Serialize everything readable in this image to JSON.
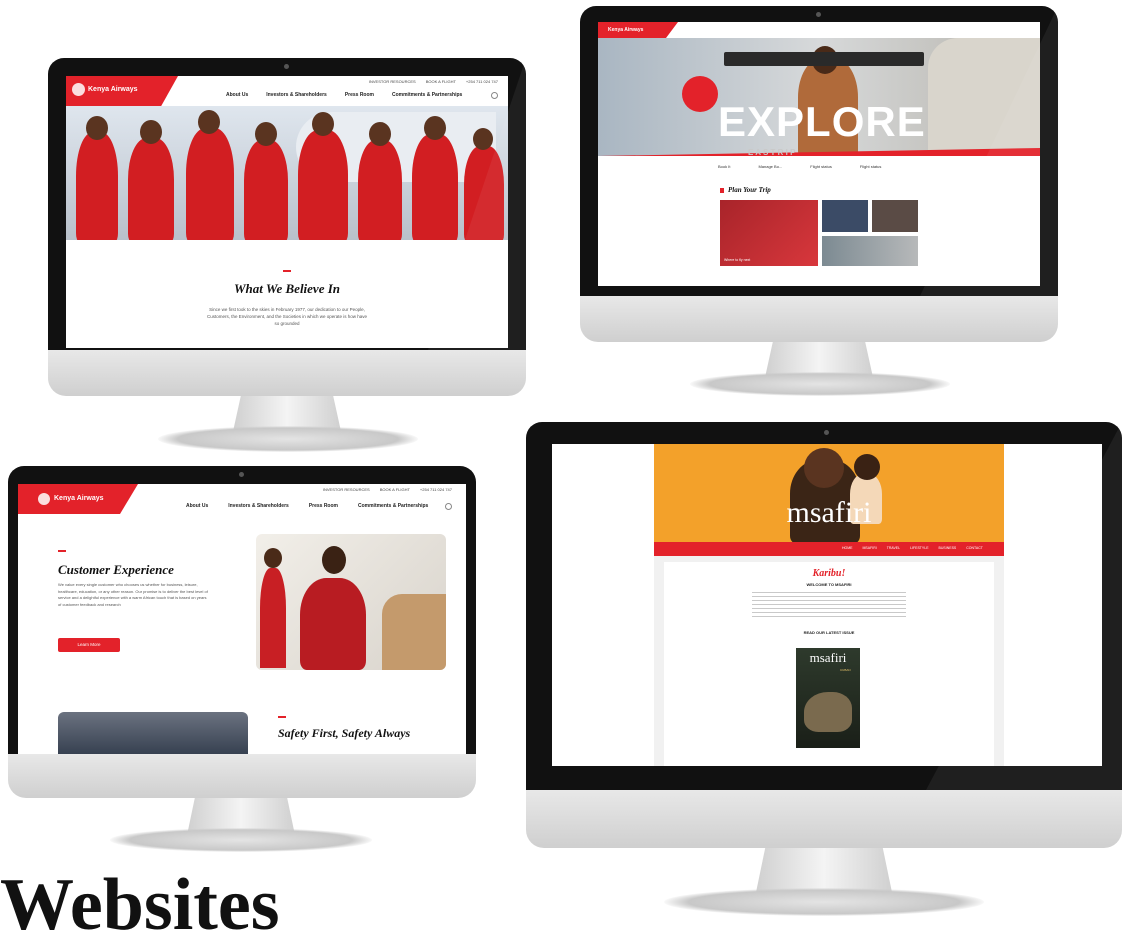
{
  "monitor1": {
    "logo_text": "Kenya Airways",
    "top_links": [
      "INVESTOR RESOURCES",
      "BOOK A FLIGHT",
      "+254 711 024 747"
    ],
    "nav": [
      "About Us",
      "Investors & Shareholders",
      "Press Room",
      "Commitments & Partnerships"
    ],
    "headline": "What We Believe In",
    "body": "Since we first took to the skies in February 1977, our dedication to our People, Customers, the Environment, and the Societies in which we operate is how have so grounded"
  },
  "monitor2": {
    "logo_text": "Kenya Airways",
    "hero_title": "EXPLORE",
    "hero_subtitle": "E A S T R I P",
    "quick_links": [
      "Book It",
      "Manage Bo...",
      "Flight status",
      "Flight status"
    ],
    "section_title": "Plan Your Trip",
    "card_caption": "Where to fly next"
  },
  "monitor3": {
    "logo_text": "Kenya Airways",
    "top_links": [
      "INVESTOR RESOURCES",
      "BOOK A FLIGHT",
      "+254 711 024 747"
    ],
    "nav": [
      "About Us",
      "Investors & Shareholders",
      "Press Room",
      "Commitments & Partnerships"
    ],
    "headline": "Customer Experience",
    "body": "We value every single customer who chooses us whether for business, leisure, healthcare, education, or any other reason. Our promise is to deliver the best level of service and a delightful experience with a warm African touch that is based on years of customer feedback and research",
    "button": "Learn More",
    "next_headline": "Safety First, Safety Always"
  },
  "monitor4": {
    "masthead": "msafiri",
    "nav": [
      "HOME",
      "MSAFIRI",
      "TRAVEL",
      "LIFESTYLE",
      "BUSINESS",
      "CONTACT"
    ],
    "greeting": "Karibu!",
    "welcome": "WELCOME TO MSAFIRI",
    "cta": "READ OUR LATEST ISSUE",
    "cover_title": "msafiri",
    "cover_subtitle": "CUBAN"
  },
  "footer_text": "Websites",
  "colors": {
    "brand_red": "#e3222a",
    "orange": "#f3a12a",
    "bezel": "#111111"
  }
}
